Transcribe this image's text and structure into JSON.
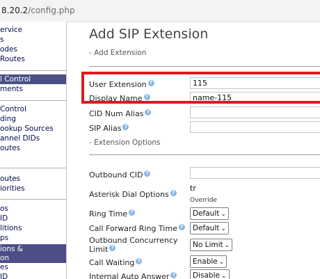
{
  "browser": {
    "url_host": "8.20.2",
    "url_path": "/config.php"
  },
  "sidebar": {
    "items": [
      {
        "label": "ervice"
      },
      {
        "label": "s"
      },
      {
        "label": "odes"
      },
      {
        "label": "Routes"
      },
      {
        "label": "l Control"
      },
      {
        "label": "ments"
      },
      {
        "label": "Control"
      },
      {
        "label": "ding"
      },
      {
        "label": "ookup Sources"
      },
      {
        "label": "annel DIDs"
      },
      {
        "label": "outes"
      },
      {
        "label": "outes"
      },
      {
        "label": "iorities"
      },
      {
        "label": "os"
      },
      {
        "label": "ID"
      },
      {
        "label": "litions"
      },
      {
        "label": "ps"
      },
      {
        "label": "ions &"
      },
      {
        "label": "on"
      },
      {
        "label": "es"
      },
      {
        "label": "ID"
      }
    ]
  },
  "page": {
    "title": "Add SIP Extension",
    "section_add": "- Add Extension",
    "section_options": "- Extension Options"
  },
  "fields": {
    "user_extension": {
      "label": "User Extension",
      "value": "115"
    },
    "display_name": {
      "label": "Display Name",
      "value": "name-115"
    },
    "cid_num_alias": {
      "label": "CID Num Alias",
      "value": ""
    },
    "sip_alias": {
      "label": "SIP Alias",
      "value": ""
    },
    "outbound_cid": {
      "label": "Outbound CID",
      "value": ""
    },
    "asterisk_dial_options": {
      "label": "Asterisk Dial Options",
      "value": "tr",
      "override": "Override"
    },
    "ring_time": {
      "label": "Ring Time",
      "value": "Default"
    },
    "call_forward_ring_time": {
      "label": "Call Forward Ring Time",
      "value": "Default"
    },
    "outbound_concurrency_limit": {
      "label_line1": "Outbound Concurrency",
      "label_line2": "Limit",
      "value": "No Limit"
    },
    "call_waiting": {
      "label": "Call Waiting",
      "value": "Enable"
    },
    "internal_auto_answer": {
      "label": "Internal Auto Answer",
      "value": "Disable"
    }
  },
  "help_glyph": "?",
  "chevron_glyph": "⌄",
  "colors": {
    "highlight": "#e0191e",
    "nav_active": "#4b4f86",
    "nav_text": "#000a4e",
    "help": "#8ab6e0"
  }
}
